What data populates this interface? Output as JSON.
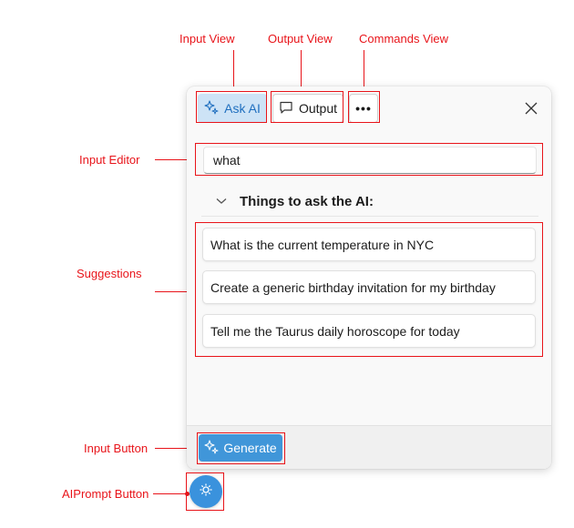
{
  "annotations": {
    "input_view": "Input View",
    "output_view": "Output View",
    "commands_view": "Commands View",
    "input_editor": "Input Editor",
    "suggestions": "Suggestions",
    "input_button": "Input Button",
    "aiprompt_button": "AIPrompt Button"
  },
  "toolbar": {
    "ask_ai_label": "Ask AI",
    "output_label": "Output",
    "more_label": "•••",
    "close_label": "✕"
  },
  "input": {
    "value": "what"
  },
  "suggestions": {
    "title": "Things to ask the AI:",
    "items": [
      {
        "label": "What is the current temperature in NYC"
      },
      {
        "label": "Create a generic birthday invitation for my birthday"
      },
      {
        "label": "Tell me the Taurus daily horoscope for today"
      }
    ]
  },
  "footer": {
    "generate_label": "Generate"
  },
  "colors": {
    "accent": "#3a92dd",
    "annotation": "#e8141a",
    "selected_tab_bg": "#cde3f6"
  },
  "icons": [
    "sparkle-icon",
    "comment-icon",
    "close-icon",
    "chevron-down-icon",
    "settings-icon"
  ]
}
